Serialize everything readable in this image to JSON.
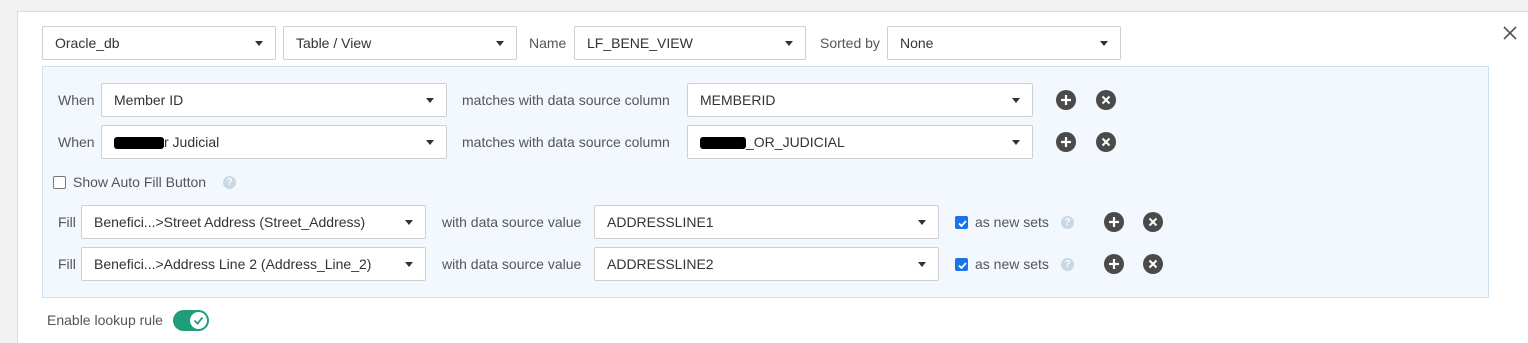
{
  "top": {
    "datasource": "Oracle_db",
    "source_type": "Table / View",
    "name_label": "Name",
    "name_value": "LF_BENE_VIEW",
    "sorted_label": "Sorted by",
    "sorted_value": "None"
  },
  "when_rows": [
    {
      "label": "When",
      "field": "Member ID",
      "match_text": "matches with data source column",
      "column": "MEMBERID"
    },
    {
      "label": "When",
      "field_suffix": "r Judicial",
      "match_text": "matches with data source column",
      "column_suffix": "_OR_JUDICIAL"
    }
  ],
  "autofill": {
    "label": "Show Auto Fill Button",
    "checked": false
  },
  "fill_rows": [
    {
      "label": "Fill",
      "field": "Benefici...>Street Address (Street_Address)",
      "with_text": "with data source value",
      "value": "ADDRESSLINE1",
      "new_sets_label": "as new sets",
      "checked": true
    },
    {
      "label": "Fill",
      "field": "Benefici...>Address Line 2 (Address_Line_2)",
      "with_text": "with data source value",
      "value": "ADDRESSLINE2",
      "new_sets_label": "as new sets",
      "checked": true
    }
  ],
  "footer": {
    "enable_label": "Enable lookup rule",
    "enabled": true
  },
  "colors": {
    "toggle_on": "#1f9d7a",
    "checkbox_on": "#1a73e8",
    "rule_bg": "#f2f8fd"
  },
  "icons": [
    "close-icon",
    "plus-icon",
    "remove-icon",
    "help-icon",
    "check-icon",
    "chevron-down-icon"
  ]
}
